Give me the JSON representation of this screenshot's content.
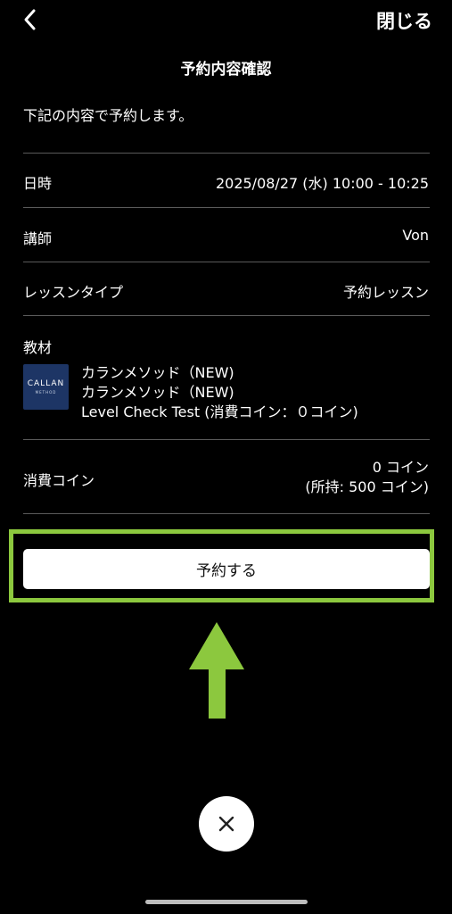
{
  "header": {
    "back_icon": "chevron-left-icon",
    "close_label": "閉じる",
    "title": "予約内容確認"
  },
  "intro_text": "下記の内容で予約します。",
  "details": {
    "datetime": {
      "label": "日時",
      "value": "2025/08/27 (水) 10:00 - 10:25"
    },
    "teacher": {
      "label": "講師",
      "value": "Von"
    },
    "lesson_type": {
      "label": "レッスンタイプ",
      "value": "予約レッスン"
    },
    "material": {
      "label": "教材",
      "thumbnail_logo": "CALLAN",
      "thumbnail_sub": "METHOD",
      "lines": [
        "カランメソッド（NEW)",
        "カランメソッド（NEW)",
        "Level Check Test (消費コイン：０コイン)"
      ]
    },
    "coins": {
      "label": "消費コイン",
      "value": "0 コイン",
      "balance": "(所持: 500 コイン)"
    }
  },
  "reserve_button_label": "予約する",
  "annotation": {
    "highlight_color": "#8cc83e",
    "arrow_icon": "arrow-up-icon"
  },
  "dismiss_icon": "close-icon"
}
